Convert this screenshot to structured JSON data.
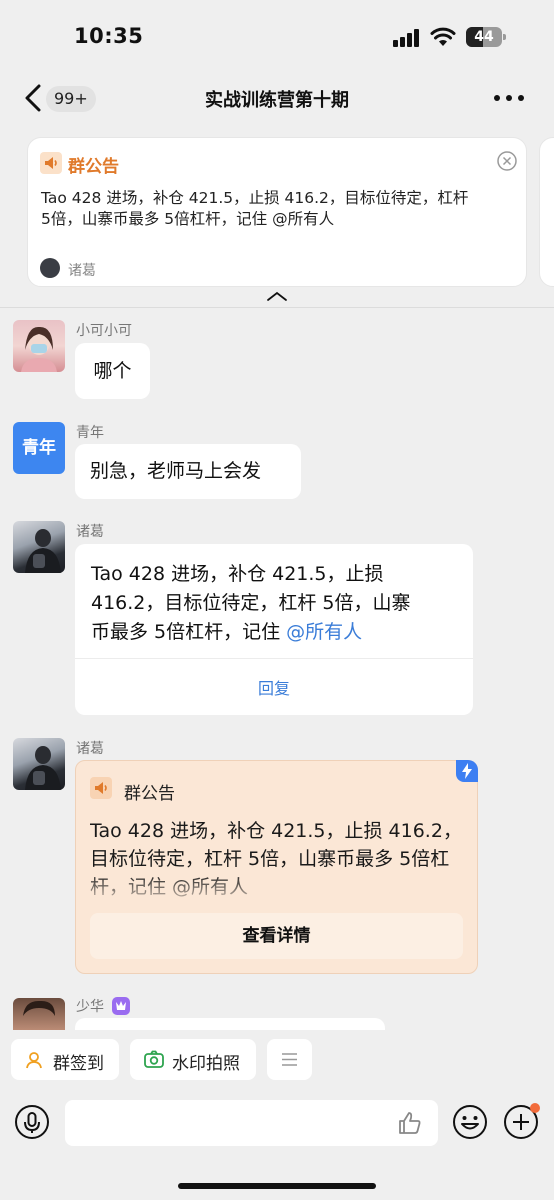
{
  "status_bar": {
    "time": "10:35",
    "battery": "44"
  },
  "nav": {
    "unread_badge": "99+",
    "title": "实战训练营第十期"
  },
  "pinned_notice": {
    "label": "群公告",
    "text": "Tao 428 进场，补仓 421.5，止损 416.2，目标位待定，杠杆 5倍，山寨币最多 5倍杠杆，记住 @所有人",
    "author": "诸葛"
  },
  "messages": [
    {
      "sender": "小可小可",
      "text": "哪个"
    },
    {
      "sender": "青年",
      "avatar_text": "青年",
      "text": "别急，老师马上会发"
    },
    {
      "sender": "诸葛",
      "text_line1": "Tao 428 进场，补仓 421.5，止损",
      "text_line2": "416.2，目标位待定，杠杆 5倍，山寨",
      "text_line3_plain": "币最多 5倍杠杆，记住 ",
      "mention": "@所有人",
      "reply_label": "回复"
    },
    {
      "sender": "诸葛",
      "notice_label": "群公告",
      "text": "Tao 428 进场，补仓 421.5，止损 416.2，目标位待定，杠杆 5倍，山寨币最多 5倍杠杆，记住 @所有人",
      "detail_label": "查看详情"
    },
    {
      "sender": "少华"
    }
  ],
  "quick_actions": [
    {
      "label": "群签到",
      "icon": "checkin-icon"
    },
    {
      "label": "水印拍照",
      "icon": "camera-icon"
    },
    {
      "label": "",
      "icon": "menu-icon"
    }
  ],
  "input": {
    "placeholder": ""
  },
  "colors": {
    "accent_blue": "#3b7dd8",
    "notice_orange": "#e07a2b",
    "notice_bg": "#fbe7d6"
  }
}
